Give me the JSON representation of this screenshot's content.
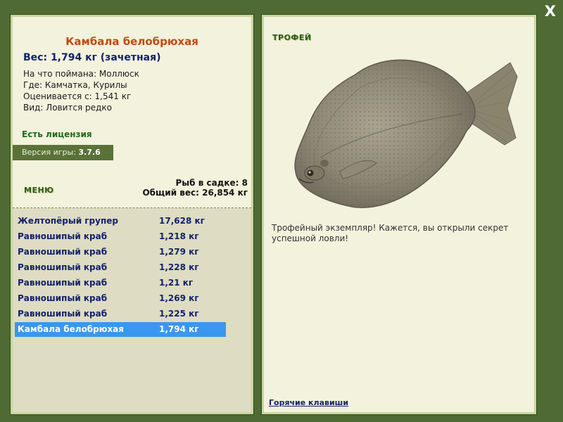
{
  "close_label": "X",
  "fish": {
    "name": "Камбала белобрюхая",
    "weight_line": "Вес: 1,794 кг (зачетная)",
    "caught_on": "На что поймана: Моллюск",
    "location": "Где: Камчатка, Курилы",
    "valued_from": "Оценивается с: 1,541 кг",
    "rarity": "Вид: Ловится редко"
  },
  "license_text": "Есть лицензия",
  "version": {
    "label": "Версия игры: ",
    "value": "3.7.6"
  },
  "menu_label": "МЕНЮ",
  "cage": {
    "count_line": "Рыб в садке: 8",
    "total_line": "Общий вес: 26,854 кг"
  },
  "catch_list": [
    {
      "name": "Желтопёрый групер",
      "weight": "17,628 кг"
    },
    {
      "name": "Равношипый краб",
      "weight": "1,218 кг"
    },
    {
      "name": "Равношипый краб",
      "weight": "1,279 кг"
    },
    {
      "name": "Равношипый краб",
      "weight": "1,228 кг"
    },
    {
      "name": "Равношипый краб",
      "weight": "1,21 кг"
    },
    {
      "name": "Равношипый краб",
      "weight": "1,269 кг"
    },
    {
      "name": "Равношипый краб",
      "weight": "1,225 кг"
    },
    {
      "name": "Камбала белобрюхая",
      "weight": "1,794 кг"
    }
  ],
  "selected_index": 7,
  "trophy_label": "ТРОФЕЙ",
  "trophy_text": "Трофейный экземпляр! Кажется, вы открыли секрет успешной ловли!",
  "hotkeys_label": "Горячие клавиши",
  "colors": {
    "background": "#4f6b33",
    "panel": "#f3f2dd",
    "title": "#c14a10",
    "text_blue": "#13216b",
    "selection": "#3a97ee",
    "license_green": "#1e6b1e"
  }
}
